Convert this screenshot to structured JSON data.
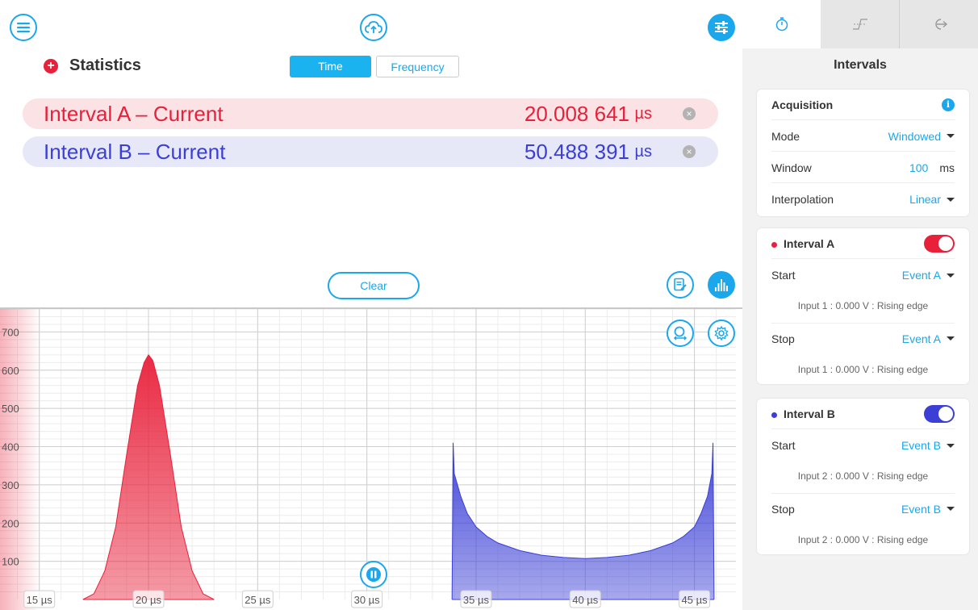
{
  "statistics": {
    "title": "Statistics",
    "tabs": {
      "time": "Time",
      "frequency": "Frequency"
    },
    "rows": [
      {
        "name": "Interval A – Current",
        "value": "20.008 641",
        "unit": "µs"
      },
      {
        "name": "Interval B – Current",
        "value": "50.488 391",
        "unit": "µs"
      }
    ],
    "clear_label": "Clear"
  },
  "colors": {
    "accent": "#1aa7ec",
    "interval_a": "#e8203a",
    "interval_b": "#3b3fd6"
  },
  "icons": {
    "menu": "menu-icon",
    "upload": "cloud-upload-icon",
    "settings": "sliders-icon",
    "report": "report-edit-icon",
    "histogram": "histogram-icon",
    "zoom": "zoom-icon",
    "gear": "gear-icon",
    "pause": "pause-icon"
  },
  "chart_data": {
    "type": "area",
    "title": "",
    "xlabel": "",
    "ylabel": "",
    "x_ticks": [
      "15 µs",
      "20 µs",
      "25 µs",
      "30 µs",
      "35 µs",
      "40 µs",
      "45 µs"
    ],
    "x_tick_values": [
      15,
      20,
      25,
      30,
      35,
      40,
      45
    ],
    "y_ticks": [
      "100",
      "200",
      "300",
      "400",
      "500",
      "600",
      "700"
    ],
    "y_tick_values": [
      100,
      200,
      300,
      400,
      500,
      600,
      700
    ],
    "xlim": [
      13.2,
      46.9
    ],
    "ylim": [
      0,
      760
    ],
    "grid": true,
    "series": [
      {
        "color": "#e8203a",
        "x": [
          17.0,
          17.5,
          18.0,
          18.5,
          19.0,
          19.5,
          19.8,
          20.0,
          20.2,
          20.5,
          21.0,
          21.5,
          22.0,
          22.5,
          23.0
        ],
        "y": [
          0,
          15,
          75,
          190,
          380,
          560,
          620,
          640,
          625,
          560,
          380,
          190,
          75,
          15,
          0
        ]
      },
      {
        "color": "#3b3fd6",
        "x": [
          33.9,
          33.95,
          34.0,
          34.3,
          34.6,
          35.0,
          35.5,
          36.0,
          37.0,
          38.0,
          39.0,
          40.0,
          41.0,
          42.0,
          43.0,
          44.0,
          44.5,
          45.0,
          45.3,
          45.6,
          45.8,
          45.85,
          45.9
        ],
        "y": [
          0,
          410,
          330,
          270,
          225,
          190,
          165,
          148,
          128,
          116,
          110,
          107,
          110,
          116,
          128,
          148,
          165,
          190,
          225,
          270,
          330,
          410,
          0
        ]
      }
    ]
  },
  "panel": {
    "title": "Intervals",
    "acquisition": {
      "label": "Acquisition",
      "mode_label": "Mode",
      "mode_value": "Windowed",
      "window_label": "Window",
      "window_value": "100",
      "window_unit": "ms",
      "interp_label": "Interpolation",
      "interp_value": "Linear"
    },
    "interval_a": {
      "label": "Interval A",
      "start_label": "Start",
      "start_value": "Event A",
      "start_desc": "Input 1 : 0.000 V : Rising edge",
      "stop_label": "Stop",
      "stop_value": "Event A",
      "stop_desc": "Input 1 : 0.000 V : Rising edge"
    },
    "interval_b": {
      "label": "Interval B",
      "start_label": "Start",
      "start_value": "Event B",
      "start_desc": "Input 2 : 0.000 V : Rising edge",
      "stop_label": "Stop",
      "stop_value": "Event B",
      "stop_desc": "Input 2 : 0.000 V : Rising edge"
    }
  }
}
